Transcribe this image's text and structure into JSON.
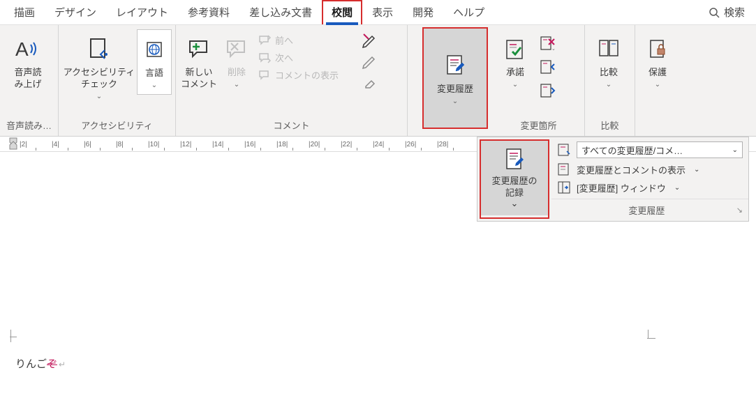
{
  "tabs": {
    "draw": "描画",
    "design": "デザイン",
    "layout": "レイアウト",
    "references": "参考資料",
    "mail": "差し込み文書",
    "review": "校閲",
    "view": "表示",
    "developer": "開発",
    "help": "ヘルプ",
    "search": "検索"
  },
  "groups": {
    "speech": {
      "label": "音声読み…",
      "readaloud": "音声読\nみ上げ"
    },
    "accessibility": {
      "label": "アクセシビリティ",
      "check": "アクセシビリティ\nチェック"
    },
    "language": {
      "btn": "言語"
    },
    "comments": {
      "label": "コメント",
      "new": "新しい\nコメント",
      "delete": "削除",
      "prev": "前へ",
      "next": "次へ",
      "show": "コメントの表示"
    },
    "tracking": {
      "btn": "変更履歴"
    },
    "changes": {
      "label": "変更箇所",
      "accept": "承諾"
    },
    "compare": {
      "label": "比較",
      "btn": "比較"
    },
    "protect": {
      "btn": "保護"
    }
  },
  "dropdown": {
    "track_record": "変更履歴の\n記録",
    "combo_value": "すべての変更履歴/コメ…",
    "show_markup": "変更履歴とコメントの表示",
    "reviewing_pane": "[変更履歴] ウィンドウ",
    "footer": "変更履歴"
  },
  "ruler": {
    "ticks": [
      2,
      4,
      6,
      8,
      10,
      12,
      14,
      16,
      18,
      20,
      22,
      24,
      26,
      28
    ]
  },
  "document": {
    "text_normal": "りんご",
    "text_struck": "ぞ",
    "para_mark": "↵"
  }
}
